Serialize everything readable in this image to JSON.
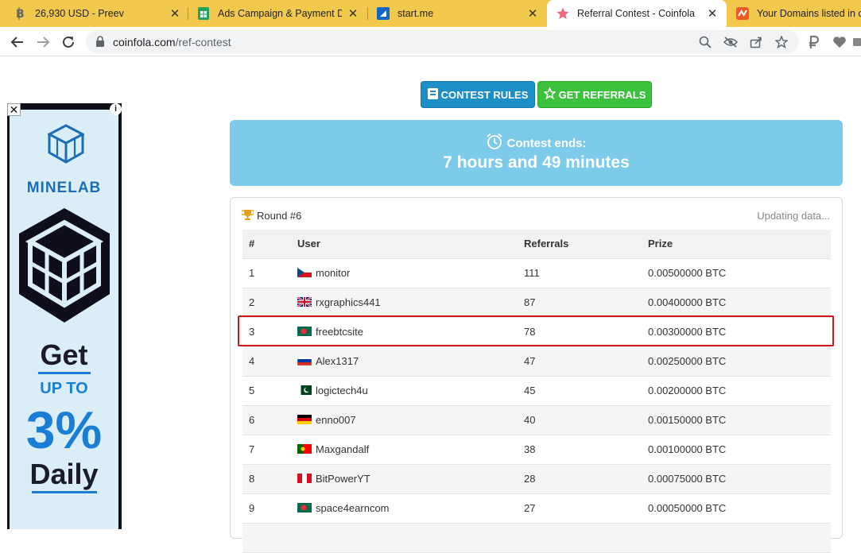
{
  "browser": {
    "tabs": [
      {
        "title": "26,930 USD - Preev",
        "favicon": "bitcoin-icon",
        "active": false
      },
      {
        "title": "Ads Campaign & Payment Det",
        "favicon": "sheets-icon",
        "active": false
      },
      {
        "title": "start.me",
        "favicon": "startme-icon",
        "active": false
      },
      {
        "title": "Referral Contest - Coinfola",
        "favicon": "star-icon",
        "active": true
      },
      {
        "title": "Your Domains listed in or",
        "favicon": "domains-icon",
        "active": false
      }
    ],
    "url_host": "coinfola.com",
    "url_path": "/ref-contest"
  },
  "ad": {
    "brand": "MINELAB",
    "line1": "Get",
    "line2": "UP TO",
    "line3": "3%",
    "line4": "Daily",
    "colors": {
      "blue": "#1a7fd4",
      "dark": "#1b1b2a",
      "bg": "#dbeef7"
    }
  },
  "buttons": {
    "rules": "CONTEST RULES",
    "referrals": "GET REFERRALS"
  },
  "countdown": {
    "label": "Contest ends:",
    "time": "7 hours and 49 minutes"
  },
  "contest": {
    "round": "Round #6",
    "status": "Updating data...",
    "columns": [
      "#",
      "User",
      "Referrals",
      "Prize"
    ],
    "rows": [
      {
        "rank": "1",
        "flag": "cz",
        "user": "monitor",
        "referrals": "111",
        "prize": "0.00500000 BTC"
      },
      {
        "rank": "2",
        "flag": "gb",
        "user": "rxgraphics441",
        "referrals": "87",
        "prize": "0.00400000 BTC"
      },
      {
        "rank": "3",
        "flag": "bd",
        "user": "freebtcsite",
        "referrals": "78",
        "prize": "0.00300000 BTC"
      },
      {
        "rank": "4",
        "flag": "ru",
        "user": "Alex1317",
        "referrals": "47",
        "prize": "0.00250000 BTC"
      },
      {
        "rank": "5",
        "flag": "pk",
        "user": "logictech4u",
        "referrals": "45",
        "prize": "0.00200000 BTC"
      },
      {
        "rank": "6",
        "flag": "de",
        "user": "enno007",
        "referrals": "40",
        "prize": "0.00150000 BTC"
      },
      {
        "rank": "7",
        "flag": "pt",
        "user": "Maxgandalf",
        "referrals": "38",
        "prize": "0.00100000 BTC"
      },
      {
        "rank": "8",
        "flag": "pe",
        "user": "BitPowerYT",
        "referrals": "28",
        "prize": "0.00075000 BTC"
      },
      {
        "rank": "9",
        "flag": "bd",
        "user": "space4earncom",
        "referrals": "27",
        "prize": "0.00050000 BTC"
      }
    ],
    "highlight_color": "#d0161b"
  }
}
